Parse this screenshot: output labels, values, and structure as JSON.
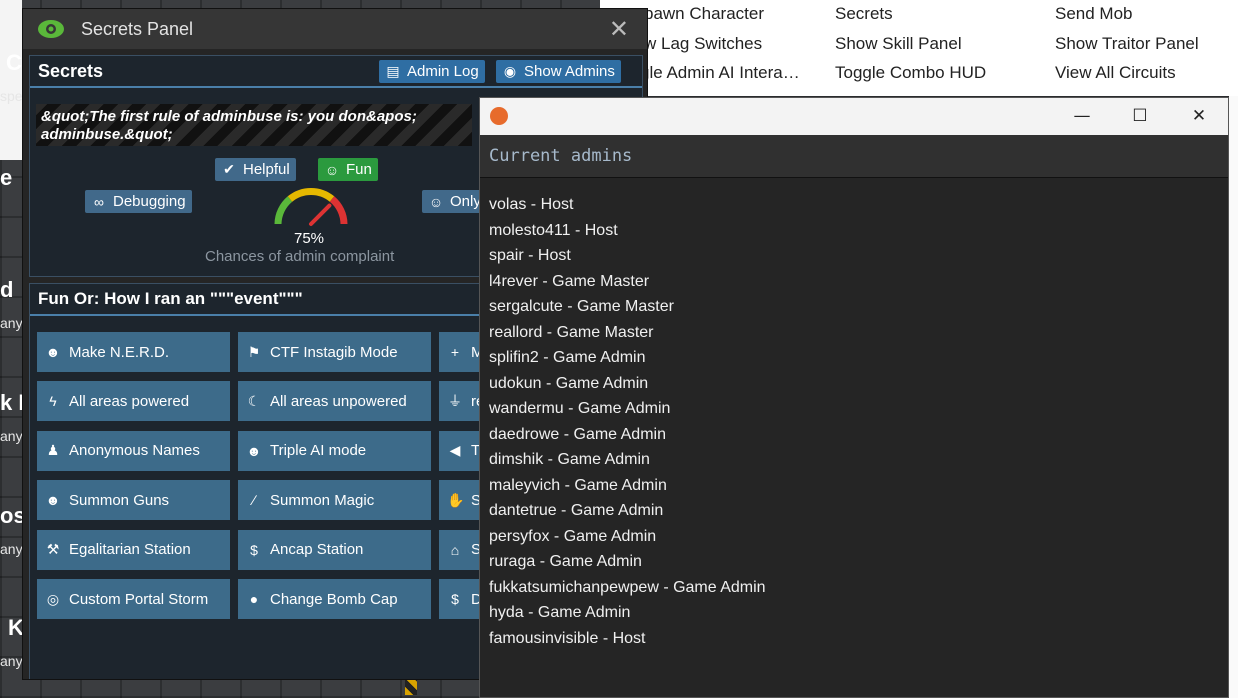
{
  "background": {
    "left_texts": [
      "C",
      "spe",
      "e",
      "d",
      "any",
      "k M",
      "any",
      "ost",
      "any",
      "Killed",
      "any?"
    ],
    "verbs": [
      [
        "pawn Character",
        "Secrets",
        "Send Mob"
      ],
      [
        "w Lag Switches",
        "Show Skill Panel",
        "Show Traitor Panel"
      ],
      [
        "gle Admin AI Intera…",
        "Toggle Combo HUD",
        "View All Circuits"
      ]
    ]
  },
  "secrets_panel": {
    "title": "Secrets Panel",
    "section_title": "Secrets",
    "admin_log_label": "Admin Log",
    "show_admins_label": "Show Admins",
    "quote": "&quot;The first rule of adminbuse is: you don&apos; adminbuse.&quot;",
    "tags": {
      "helpful": "Helpful",
      "fun": "Fun",
      "debugging": "Debugging",
      "only": "Only"
    },
    "gauge": {
      "value_text": "75%",
      "value": 0.75,
      "caption": "Chances of admin complaint"
    },
    "fun_section_title": "Fun Or: How I ran an \"\"\"event\"\"\"",
    "buttons": [
      [
        "Make N.E.R.D.",
        "CTF Instagib Mode",
        "M"
      ],
      [
        "All areas powered",
        "All areas unpowered",
        "re"
      ],
      [
        "Anonymous Names",
        "Triple AI mode",
        "Th"
      ],
      [
        "Summon Guns",
        "Summon Magic",
        "Su"
      ],
      [
        "Egalitarian Station",
        "Ancap Station",
        "Se"
      ],
      [
        "Custom Portal Storm",
        "Change Bomb Cap",
        "D"
      ]
    ],
    "button_icons": [
      [
        "robot-icon",
        "flag-icon",
        "plus-icon"
      ],
      [
        "bolt-icon",
        "moon-icon",
        "plug-icon"
      ],
      [
        "user-secret-icon",
        "robot-icon",
        "bullhorn-icon"
      ],
      [
        "grin-icon",
        "wand-icon",
        "hand-icon"
      ],
      [
        "hammer-icon",
        "dollar-icon",
        "home-icon"
      ],
      [
        "target-icon",
        "bomb-icon",
        "dollar-icon"
      ]
    ]
  },
  "admins_window": {
    "heading": "Current admins",
    "admins": [
      "volas - Host",
      "molesto411 - Host",
      "spair - Host",
      "l4rever - Game Master",
      "sergalcute - Game Master",
      "reallord - Game Master",
      "splifin2 - Game Admin",
      "udokun - Game Admin",
      "wandermu - Game Admin",
      "daedrowe - Game Admin",
      "dimshik - Game Admin",
      "maleyvich - Game Admin",
      "dantetrue - Game Admin",
      "persyfox - Game Admin",
      "ruraga - Game Admin",
      "fukkatsumichanpewpew - Game Admin",
      "hyda - Game Admin",
      "famousinvisible - Host"
    ]
  },
  "colors": {
    "accent_blue": "#2f6ea3",
    "fun_green": "#2b9a3e",
    "grid_button": "#3d6b8a",
    "panel_bg": "#252525"
  }
}
